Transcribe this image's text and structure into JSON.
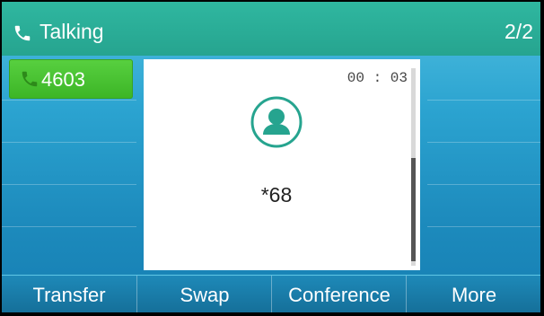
{
  "header": {
    "title": "Talking",
    "title_icon": "phone-icon",
    "call_count": "2/2"
  },
  "line_keys": {
    "left": [
      {
        "label": "4603",
        "icon": "phone-icon",
        "active": true,
        "color": "#4cc332"
      }
    ]
  },
  "call_card": {
    "duration": "00 : 03",
    "avatar_icon": "contact-avatar-icon",
    "number": "*68",
    "accent": "#26a48f"
  },
  "softkeys": [
    {
      "label": "Transfer"
    },
    {
      "label": "Swap"
    },
    {
      "label": "Conference"
    },
    {
      "label": "More"
    }
  ]
}
